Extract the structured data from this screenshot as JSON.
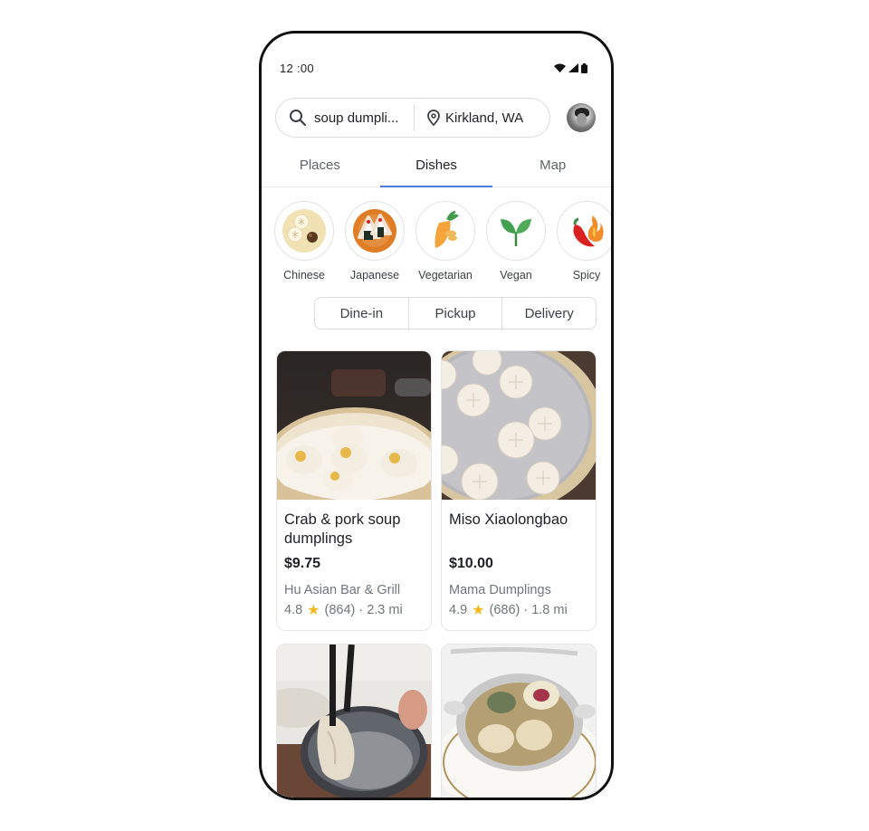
{
  "status_bar": {
    "time": "12 :00",
    "icons": [
      "wifi-icon",
      "signal-icon",
      "battery-icon"
    ]
  },
  "search": {
    "query": "soup dumpli...",
    "location": "Kirkland, WA",
    "search_icon": "search-icon",
    "location_icon": "location-pin-icon"
  },
  "tabs": [
    {
      "label": "Places",
      "active": false
    },
    {
      "label": "Dishes",
      "active": true
    },
    {
      "label": "Map",
      "active": false
    }
  ],
  "categories": [
    {
      "label": "Chinese",
      "icon": "dumplings-icon"
    },
    {
      "label": "Japanese",
      "icon": "onigiri-icon"
    },
    {
      "label": "Vegetarian",
      "icon": "carrot-icon"
    },
    {
      "label": "Vegan",
      "icon": "sprout-icon"
    },
    {
      "label": "Spicy",
      "icon": "chili-flame-icon"
    }
  ],
  "service_options": [
    "Dine-in",
    "Pickup",
    "Delivery"
  ],
  "dishes": [
    {
      "title": "Crab & pork soup dumplings",
      "price": "$9.75",
      "restaurant": "Hu Asian Bar & Grill",
      "rating": "4.8",
      "reviews": "(864)",
      "distance": "2.3 mi"
    },
    {
      "title": "Miso Xiaolongbao",
      "price": "$10.00",
      "restaurant": "Mama Dumplings",
      "rating": "4.9",
      "reviews": "(686)",
      "distance": "1.8 mi"
    },
    {
      "image": "dumpling-with-chopsticks-photo"
    },
    {
      "image": "dumpling-soup-bowl-photo"
    }
  ],
  "colors": {
    "accent": "#4a7bd6",
    "star": "#f6b81f",
    "secondary_text": "#70757a"
  },
  "separator": "·"
}
